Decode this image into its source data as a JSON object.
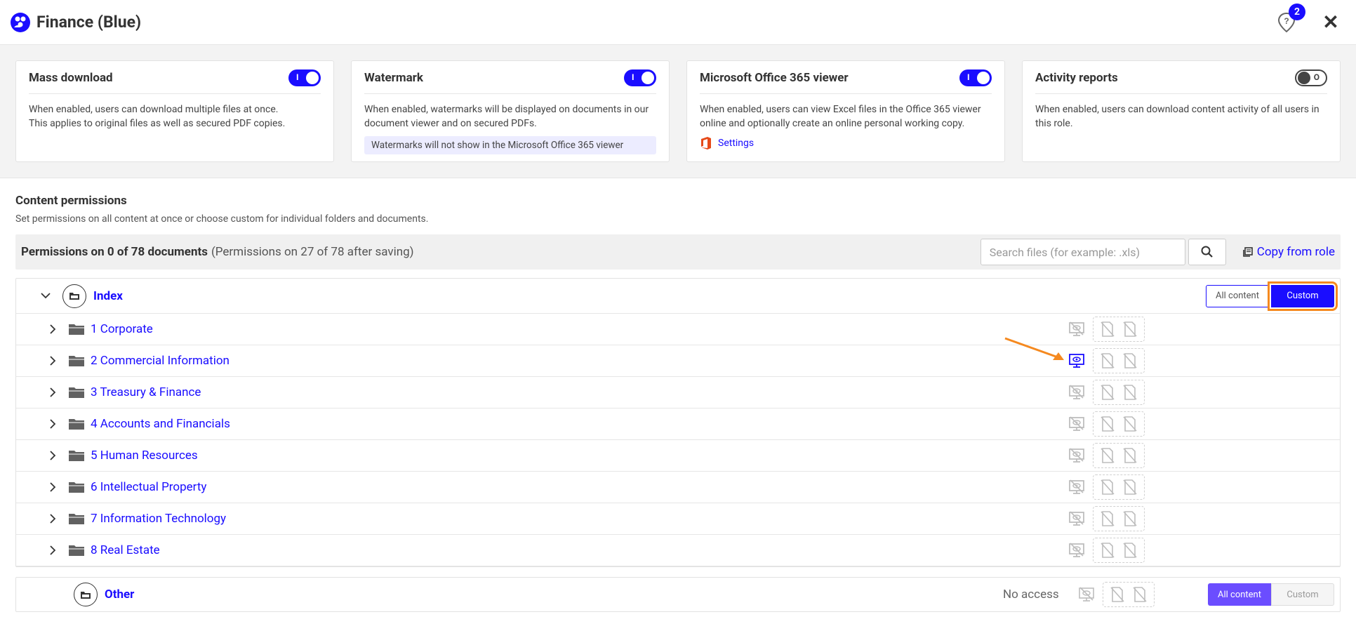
{
  "header": {
    "title": "Finance (Blue)",
    "help_badge": "2"
  },
  "cards": [
    {
      "title": "Mass download",
      "toggle": "on",
      "toggle_mark": "I",
      "text": "When enabled, users can download multiple files at once.",
      "text2": "This applies to original files as well as secured PDF copies."
    },
    {
      "title": "Watermark",
      "toggle": "on",
      "toggle_mark": "I",
      "text": "When enabled, watermarks will be displayed on documents in our document viewer and on secured PDFs.",
      "note": "Watermarks will not show in the Microsoft Office 365 viewer"
    },
    {
      "title": "Microsoft Office 365 viewer",
      "toggle": "on",
      "toggle_mark": "I",
      "text": "When enabled, users can view Excel files in the Office 365 viewer online and optionally create an online personal working copy.",
      "link": "Settings"
    },
    {
      "title": "Activity reports",
      "toggle": "off",
      "toggle_mark": "O",
      "text": "When enabled, users can download content activity of all users in this role."
    }
  ],
  "permissions": {
    "title": "Content permissions",
    "subtitle": "Set permissions on all content at once or choose custom for individual folders and documents.",
    "count": "Permissions on 0 of 78 documents",
    "after": "(Permissions on 27 of 78 after saving)",
    "search_placeholder": "Search files (for example: .xls)",
    "copy_label": "Copy from role"
  },
  "tree": {
    "root": {
      "name": "Index",
      "all_label": "All content",
      "custom_label": "Custom"
    },
    "rows": [
      {
        "name": "1 Corporate",
        "view_active": false
      },
      {
        "name": "2 Commercial Information",
        "view_active": true
      },
      {
        "name": "3 Treasury & Finance",
        "view_active": false
      },
      {
        "name": "4 Accounts and Financials",
        "view_active": false
      },
      {
        "name": "5 Human Resources",
        "view_active": false
      },
      {
        "name": "6 Intellectual Property",
        "view_active": false
      },
      {
        "name": "7 Information Technology",
        "view_active": false
      },
      {
        "name": "8 Real Estate",
        "view_active": false
      }
    ]
  },
  "other": {
    "name": "Other",
    "status": "No access",
    "all_label": "All content",
    "custom_label": "Custom"
  },
  "colors": {
    "accent": "#1a0dff",
    "highlight": "#f5891f",
    "inactive_icon": "#bdbdbd"
  }
}
